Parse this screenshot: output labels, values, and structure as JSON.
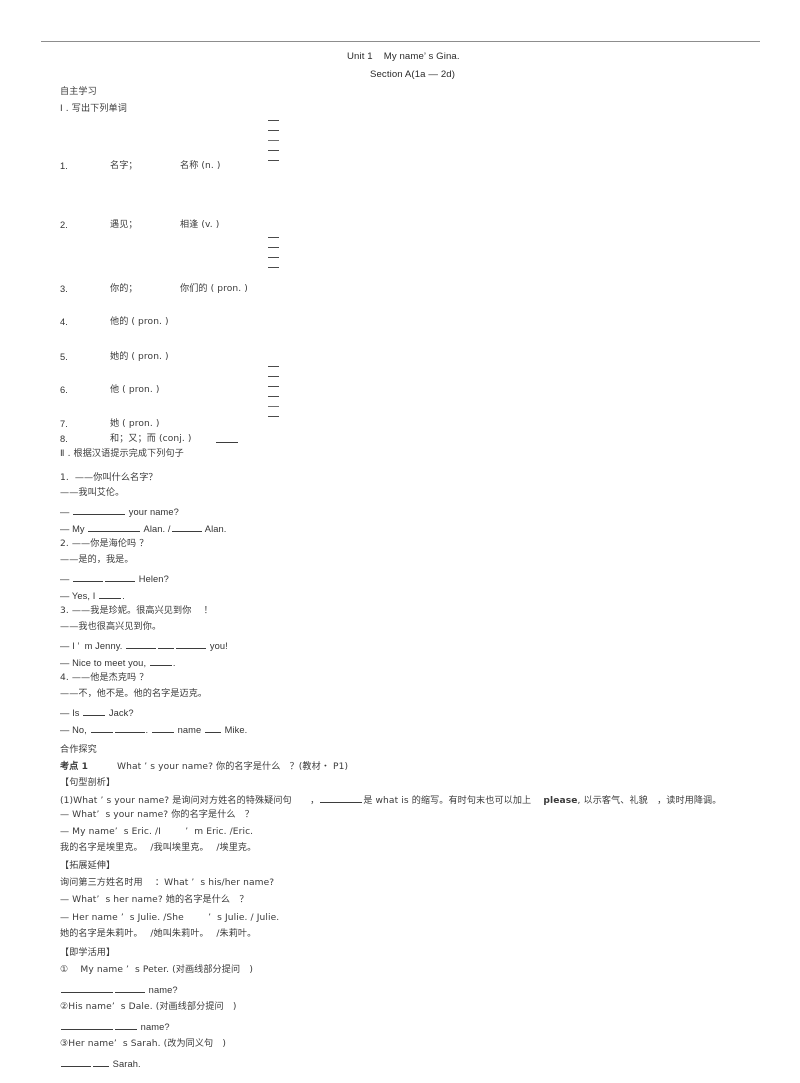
{
  "document": {
    "title_line1": "Unit 1    My name’ s Gina.",
    "title_line2": "Section A(1a — 2d)"
  },
  "sections": {
    "self_study_heading": "自主学习",
    "part1_heading": "Ⅰ . 写出下列单词",
    "part2_heading": "Ⅱ . 根据汉语提示完成下列句子",
    "cooperative_heading": "合作探究"
  },
  "vocabulary": [
    {
      "num": "1.",
      "cn1": "名字；",
      "cn2": "名称 (n. )"
    },
    {
      "num": "2.",
      "cn1": "遇见；",
      "cn2": "相逢 (v. )"
    },
    {
      "num": "3.",
      "cn1": "你的；",
      "cn2": "你们的 ( pron. )"
    },
    {
      "num": "4.",
      "cn1": "他的 ( pron. )",
      "cn2": ""
    },
    {
      "num": "5.",
      "cn1": "她的 ( pron. )",
      "cn2": ""
    },
    {
      "num": "6.",
      "cn1": "他 ( pron. )",
      "cn2": ""
    },
    {
      "num": "7.",
      "cn1": "她 ( pron. )",
      "cn2": ""
    },
    {
      "num": "8.",
      "cn1": "和；又；而 (conj. )",
      "cn2": ""
    }
  ],
  "part2_items": [
    {
      "q_cn": "1.  ——你叫什么名字？",
      "a_cn": "——我叫艾伦。",
      "q_en_pre": "— ",
      "q_en_post": " your name?",
      "a_en_pre": "— My ",
      "a_en_mid": " Alan. /",
      "a_en_post": " Alan."
    },
    {
      "q_cn": "2. ——你是海伦吗 ？",
      "a_cn": "——是的，我是。",
      "q_en_pre": "— ",
      "q_en_post": " Helen?",
      "a_en_pre": "— Yes, I ",
      "a_en_post": "."
    },
    {
      "q_cn": "3. ——我是珍妮。很高兴见到你　 ！",
      "a_cn": "——我也很高兴见到你。",
      "q_en_pre": "— I ’  m Jenny. ",
      "q_en_post": " you!",
      "a_en_pre": "— Nice to meet you, ",
      "a_en_post": "."
    },
    {
      "q_cn": "4. ——他是杰克吗 ？",
      "a_cn": "——不，他不是。他的名字是迈克。",
      "q_en_pre": "— Is ",
      "q_en_post": " Jack?",
      "a_en_pre": "— No, ",
      "a_en_mid": ". ",
      "a_en_mid2": " name ",
      "a_en_post": " Mike."
    }
  ],
  "kaodian": {
    "label": "考点 1",
    "headline": "What ’ s your name? 你的名字是什么　？(教材・ P1)",
    "analysis_heading": "【句型剖析】",
    "analysis_pre": "(1)What ’ s your name? 是询问对方姓名的特殊疑问句　　，",
    "analysis_mid": "是 what is 的缩写。有时句末也可以加上　 ",
    "analysis_bold": "please",
    "analysis_post": ", 以示客气、礼貌　，读时用降调。",
    "example_q": "— What’  s your name? 你的名字是什么　？",
    "example_a": "— My name’  s Eric. /I 　　 ’  m Eric. /Eric.",
    "example_a_cn": "我的名字是埃里克。　 /我叫埃里克。　 /埃里克。",
    "extension_heading": "【拓展延伸】",
    "extension_line": "询问第三方姓名时用　 ：What ’  s his/her name?",
    "extension_q": "— What’  s her name? 她的名字是什么　？",
    "extension_a": "— Her name ’  s Julie. /She 　　 ’  s Julie. / Julie.",
    "extension_a_cn": "她的名字是朱莉叶。　 /她叫朱莉叶。　 /朱莉叶。",
    "apply_heading": "【即学活用】"
  },
  "apply_items": [
    {
      "prompt": "①　 My name ’  s Peter. (对画线部分提问　)",
      "answer_post": " name?"
    },
    {
      "prompt": "②His name’  s Dale. (对画线部分提问　)",
      "answer_post": " name?"
    },
    {
      "prompt": "③Her name’  s Sarah. (改为同义句　)",
      "answer_post": " Sarah."
    }
  ]
}
